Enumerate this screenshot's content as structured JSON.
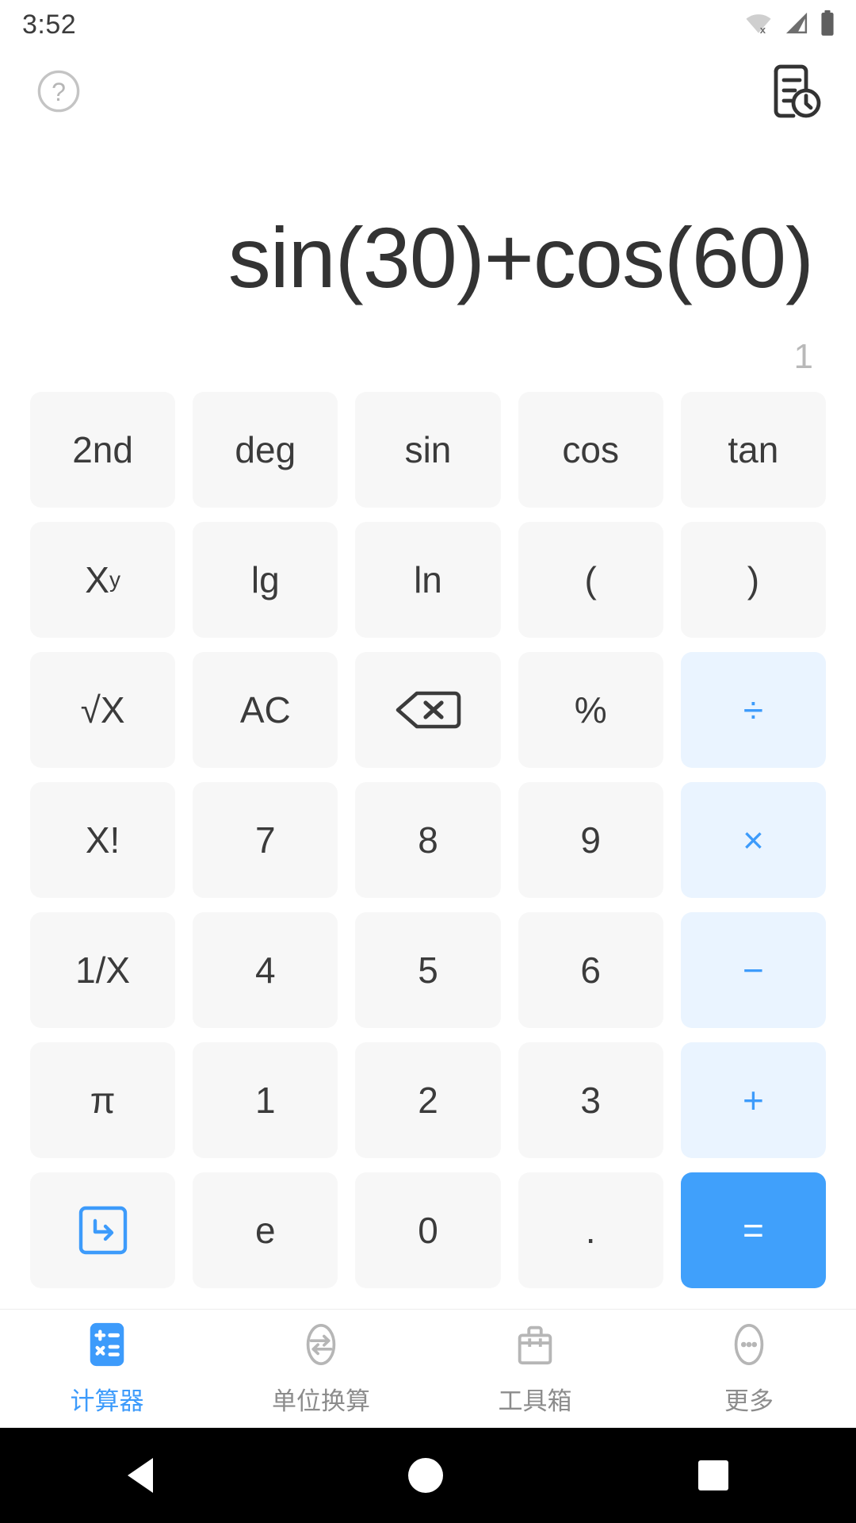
{
  "status_bar": {
    "time": "3:52",
    "icons": [
      "wifi-off-icon",
      "cellular-signal-icon",
      "battery-icon"
    ]
  },
  "top_bar": {
    "help_icon": "help-circle-icon",
    "history_icon": "history-document-icon"
  },
  "display": {
    "expression": "sin(30)+cos(60)",
    "result": "1"
  },
  "colors": {
    "accent": "#3d9bfb",
    "equals_bg": "#40a0fb",
    "operator_bg": "#eaf4ff",
    "key_bg": "#f7f7f7",
    "key_text": "#3b3b3b",
    "result_text": "#b9b9b9",
    "expression_text": "#333333"
  },
  "keypad": {
    "rows": [
      [
        {
          "label": "2nd",
          "name": "key-second",
          "type": "func"
        },
        {
          "label": "deg",
          "name": "key-deg",
          "type": "func"
        },
        {
          "label": "sin",
          "name": "key-sin",
          "type": "func"
        },
        {
          "label": "cos",
          "name": "key-cos",
          "type": "func"
        },
        {
          "label": "tan",
          "name": "key-tan",
          "type": "func"
        }
      ],
      [
        {
          "label": "X",
          "sup": "y",
          "name": "key-power",
          "type": "func"
        },
        {
          "label": "lg",
          "name": "key-lg",
          "type": "func"
        },
        {
          "label": "ln",
          "name": "key-ln",
          "type": "func"
        },
        {
          "label": "(",
          "name": "key-open-paren",
          "type": "func"
        },
        {
          "label": ")",
          "name": "key-close-paren",
          "type": "func"
        }
      ],
      [
        {
          "label": "√X",
          "name": "key-square-root",
          "type": "func"
        },
        {
          "label": "AC",
          "name": "key-all-clear",
          "type": "func"
        },
        {
          "label": "⌫",
          "name": "key-backspace",
          "type": "icon"
        },
        {
          "label": "%",
          "name": "key-percent",
          "type": "func"
        },
        {
          "label": "÷",
          "name": "key-divide",
          "type": "op"
        }
      ],
      [
        {
          "label": "X!",
          "name": "key-factorial",
          "type": "func"
        },
        {
          "label": "7",
          "name": "key-7",
          "type": "digit"
        },
        {
          "label": "8",
          "name": "key-8",
          "type": "digit"
        },
        {
          "label": "9",
          "name": "key-9",
          "type": "digit"
        },
        {
          "label": "×",
          "name": "key-multiply",
          "type": "op"
        }
      ],
      [
        {
          "label": "1/X",
          "name": "key-reciprocal",
          "type": "func"
        },
        {
          "label": "4",
          "name": "key-4",
          "type": "digit"
        },
        {
          "label": "5",
          "name": "key-5",
          "type": "digit"
        },
        {
          "label": "6",
          "name": "key-6",
          "type": "digit"
        },
        {
          "label": "−",
          "name": "key-minus",
          "type": "op"
        }
      ],
      [
        {
          "label": "π",
          "name": "key-pi",
          "type": "func"
        },
        {
          "label": "1",
          "name": "key-1",
          "type": "digit"
        },
        {
          "label": "2",
          "name": "key-2",
          "type": "digit"
        },
        {
          "label": "3",
          "name": "key-3",
          "type": "digit"
        },
        {
          "label": "+",
          "name": "key-plus",
          "type": "op"
        }
      ],
      [
        {
          "label": "",
          "name": "key-enter-arrow",
          "type": "icon-box"
        },
        {
          "label": "e",
          "name": "key-e",
          "type": "func"
        },
        {
          "label": "0",
          "name": "key-0",
          "type": "digit"
        },
        {
          "label": ".",
          "name": "key-decimal",
          "type": "digit"
        },
        {
          "label": "=",
          "name": "key-equals",
          "type": "equals"
        }
      ]
    ]
  },
  "tab_bar": {
    "tabs": [
      {
        "label": "计算器",
        "icon": "calculator-icon",
        "name": "tab-calculator",
        "active": true
      },
      {
        "label": "单位换算",
        "icon": "unit-convert-icon",
        "name": "tab-unit-conversion",
        "active": false
      },
      {
        "label": "工具箱",
        "icon": "toolbox-icon",
        "name": "tab-toolbox",
        "active": false
      },
      {
        "label": "更多",
        "icon": "more-dots-icon",
        "name": "tab-more",
        "active": false
      }
    ]
  },
  "nav_bar": {
    "back": "back-triangle-icon",
    "home": "home-circle-icon",
    "recents": "recents-square-icon"
  }
}
